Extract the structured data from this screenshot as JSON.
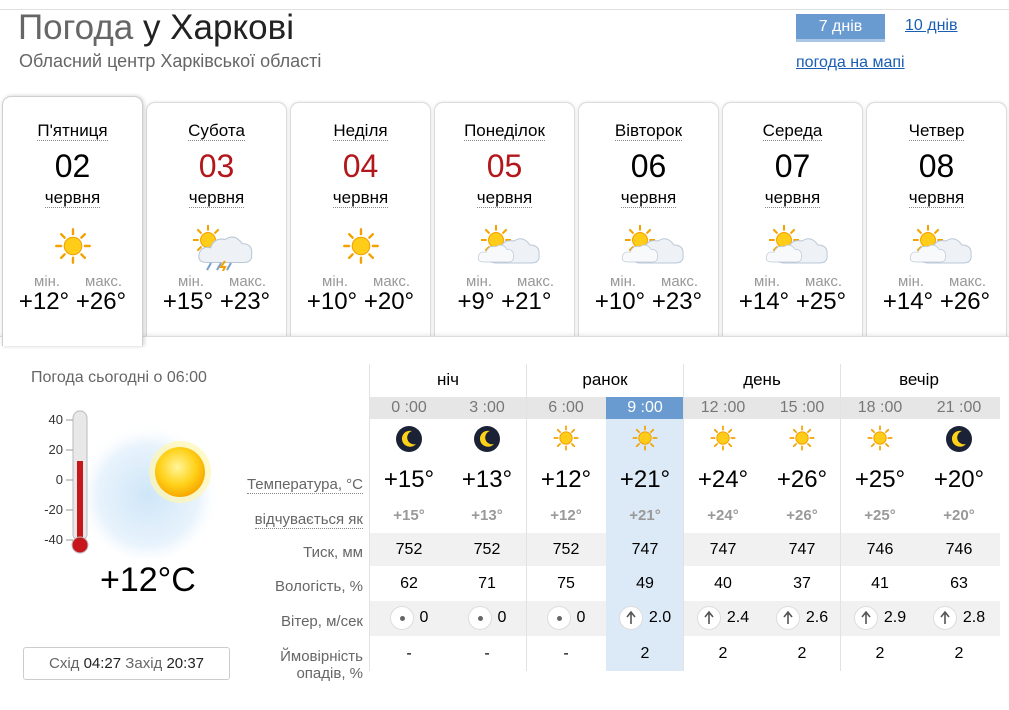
{
  "header": {
    "title_prefix": "Погода",
    "title_city": "у Харкові",
    "subtitle": "Обласний центр Харківської області",
    "btn_7days": "7 днів",
    "link_10days": "10 днів",
    "link_map": "погода на мапі"
  },
  "days": [
    {
      "name": "П'ятниця",
      "num": "02",
      "month": "червня",
      "icon": "sun-icon",
      "min_label": "мін.",
      "max_label": "макс.",
      "min": "+12°",
      "max": "+26°",
      "weekend": false,
      "active": true
    },
    {
      "name": "Субота",
      "num": "03",
      "month": "червня",
      "icon": "storm-cloud-sun-icon",
      "min_label": "мін.",
      "max_label": "макс.",
      "min": "+15°",
      "max": "+23°",
      "weekend": true,
      "active": false
    },
    {
      "name": "Неділя",
      "num": "04",
      "month": "червня",
      "icon": "sun-icon",
      "min_label": "мін.",
      "max_label": "макс.",
      "min": "+10°",
      "max": "+20°",
      "weekend": true,
      "active": false
    },
    {
      "name": "Понеділок",
      "num": "05",
      "month": "червня",
      "icon": "partly-cloudy-icon",
      "min_label": "мін.",
      "max_label": "макс.",
      "min": "+9°",
      "max": "+21°",
      "weekend": true,
      "active": false
    },
    {
      "name": "Вівторок",
      "num": "06",
      "month": "червня",
      "icon": "partly-cloudy-icon",
      "min_label": "мін.",
      "max_label": "макс.",
      "min": "+10°",
      "max": "+23°",
      "weekend": false,
      "active": false
    },
    {
      "name": "Середа",
      "num": "07",
      "month": "червня",
      "icon": "partly-cloudy-icon",
      "min_label": "мін.",
      "max_label": "макс.",
      "min": "+14°",
      "max": "+25°",
      "weekend": false,
      "active": false
    },
    {
      "name": "Четвер",
      "num": "08",
      "month": "червня",
      "icon": "partly-cloudy-icon",
      "min_label": "мін.",
      "max_label": "макс.",
      "min": "+14°",
      "max": "+26°",
      "weekend": false,
      "active": false
    }
  ],
  "now": {
    "label": "Погода сьогодні о 06:00",
    "temp": "+12°C",
    "thermo_ticks": [
      "40",
      "20",
      "0",
      "-20",
      "-40"
    ],
    "sunrise_label": "Схід",
    "sunrise": "04:27",
    "sunset_label": "Захід",
    "sunset": "20:37"
  },
  "rows": {
    "temp": "Температура, °C",
    "feels": "відчувається як",
    "pressure": "Тиск, мм",
    "humidity": "Вологість, %",
    "wind": "Вітер, м/сек",
    "precip_1": "Ймовірність",
    "precip_2": "опадів, %"
  },
  "periods": [
    "ніч",
    "ранок",
    "день",
    "вечір"
  ],
  "hours": [
    {
      "time": "0 :00",
      "icon": "moon-icon",
      "temp": "+15°",
      "feels": "+15°",
      "pressure": "752",
      "humidity": "62",
      "wind": "0",
      "wind_dir": "calm",
      "precip": "-"
    },
    {
      "time": "3 :00",
      "icon": "moon-icon",
      "temp": "+13°",
      "feels": "+13°",
      "pressure": "752",
      "humidity": "71",
      "wind": "0",
      "wind_dir": "calm",
      "precip": "-"
    },
    {
      "time": "6 :00",
      "icon": "sun-icon",
      "temp": "+12°",
      "feels": "+12°",
      "pressure": "752",
      "humidity": "75",
      "wind": "0",
      "wind_dir": "calm",
      "precip": "-"
    },
    {
      "time": "9 :00",
      "icon": "sun-icon",
      "temp": "+21°",
      "feels": "+21°",
      "pressure": "747",
      "humidity": "49",
      "wind": "2.0",
      "wind_dir": "south",
      "precip": "2"
    },
    {
      "time": "12 :00",
      "icon": "sun-icon",
      "temp": "+24°",
      "feels": "+24°",
      "pressure": "747",
      "humidity": "40",
      "wind": "2.4",
      "wind_dir": "south",
      "precip": "2"
    },
    {
      "time": "15 :00",
      "icon": "sun-icon",
      "temp": "+26°",
      "feels": "+26°",
      "pressure": "747",
      "humidity": "37",
      "wind": "2.6",
      "wind_dir": "south",
      "precip": "2"
    },
    {
      "time": "18 :00",
      "icon": "sun-icon",
      "temp": "+25°",
      "feels": "+25°",
      "pressure": "746",
      "humidity": "41",
      "wind": "2.9",
      "wind_dir": "south",
      "precip": "2"
    },
    {
      "time": "21 :00",
      "icon": "moon-icon",
      "temp": "+20°",
      "feels": "+20°",
      "pressure": "746",
      "humidity": "63",
      "wind": "2.8",
      "wind_dir": "south",
      "precip": "2"
    }
  ],
  "colors": {
    "accent": "#6a9bd0",
    "weekend": "#b3171b",
    "link": "#1a5fb4",
    "highlight": "#dce9f6"
  }
}
